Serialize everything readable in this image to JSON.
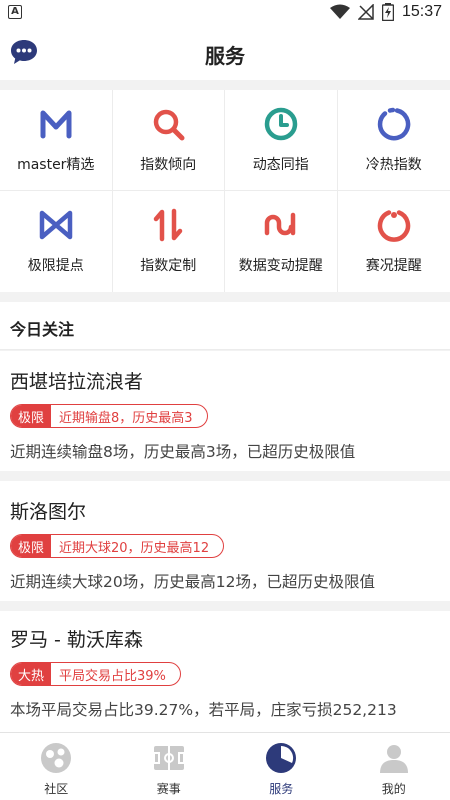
{
  "status_bar": {
    "time": "15:37",
    "app_badge": "A"
  },
  "header": {
    "title": "服务"
  },
  "grid": [
    {
      "label": "master精选",
      "icon": "m-logo-icon",
      "color": "#4a5fc1"
    },
    {
      "label": "指数倾向",
      "icon": "search-magnifier-icon",
      "color": "#e2524a"
    },
    {
      "label": "动态同指",
      "icon": "clock-icon",
      "color": "#2a9d8f"
    },
    {
      "label": "冷热指数",
      "icon": "ring-icon",
      "color": "#4a5fc1"
    },
    {
      "label": "极限提点",
      "icon": "bowtie-icon",
      "color": "#4a5fc1"
    },
    {
      "label": "指数定制",
      "icon": "up-down-arrows-icon",
      "color": "#e2524a"
    },
    {
      "label": "数据变动提醒",
      "icon": "wave-icon",
      "color": "#e2524a"
    },
    {
      "label": "赛况提醒",
      "icon": "refresh-ring-icon",
      "color": "#e2524a"
    }
  ],
  "today": {
    "heading": "今日关注",
    "cards": [
      {
        "title": "西堪培拉流浪者",
        "tag": "极限",
        "tag_text": "近期输盘8，历史最高3",
        "desc": "近期连续输盘8场，历史最高3场，已超历史极限值"
      },
      {
        "title": "斯洛图尔",
        "tag": "极限",
        "tag_text": "近期大球20，历史最高12",
        "desc": "近期连续大球20场，历史最高12场，已超历史极限值"
      },
      {
        "title": "罗马 - 勒沃库森",
        "tag": "大热",
        "tag_text": "平局交易占比39%",
        "desc": "本场平局交易占比39.27%，若平局，庄家亏损252,213"
      }
    ]
  },
  "nav": [
    {
      "label": "社区",
      "icon": "community-icon"
    },
    {
      "label": "赛事",
      "icon": "match-field-icon"
    },
    {
      "label": "服务",
      "icon": "service-icon",
      "active": true
    },
    {
      "label": "我的",
      "icon": "profile-icon"
    }
  ],
  "colors": {
    "accent": "#e04040",
    "brand": "#2d3a7a",
    "blue_icon": "#4a5fc1",
    "red_icon": "#e2524a",
    "green_icon": "#2a9d8f"
  }
}
